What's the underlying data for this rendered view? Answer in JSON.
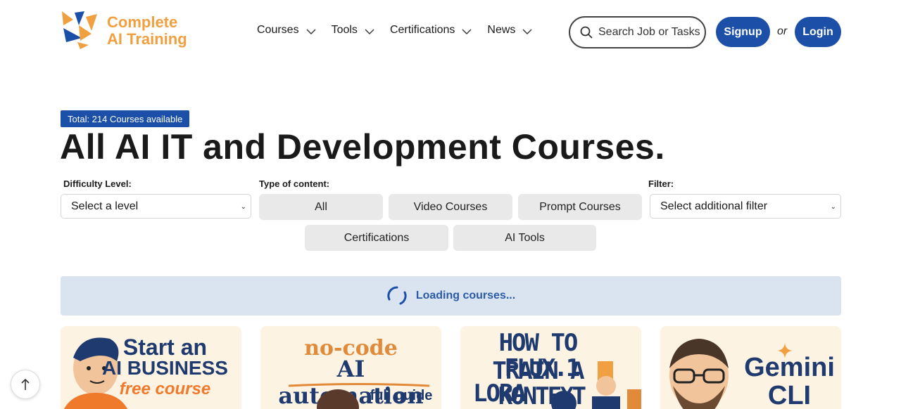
{
  "brand": {
    "line1": "Complete",
    "line2": "AI Training"
  },
  "nav": [
    {
      "label": "Courses"
    },
    {
      "label": "Tools"
    },
    {
      "label": "Certifications"
    },
    {
      "label": "News"
    }
  ],
  "search": {
    "placeholder": "Search Job or Tasks"
  },
  "auth": {
    "signup": "Signup",
    "or": "or",
    "login": "Login"
  },
  "badge": "Total: 214 Courses available",
  "page_title": "All AI IT and Development Courses.",
  "filters": {
    "difficulty_label": "Difficulty Level:",
    "difficulty_value": "Select a level",
    "type_label": "Type of content:",
    "filter_label": "Filter:",
    "filter_value": "Select additional filter",
    "types": [
      "All",
      "Video Courses",
      "Prompt Courses",
      "Certifications",
      "AI Tools"
    ]
  },
  "loading_text": "Loading courses...",
  "cards": [
    {
      "l1": "Start an",
      "l2": "AI BUSINESS",
      "l3": "free course"
    },
    {
      "l1": "no-code",
      "l2": "AI automation",
      "l3": "full guide"
    },
    {
      "l1": "HOW TO TRAIN A",
      "l2": "FLUX.1 KONTEXT",
      "l3": "LORA"
    },
    {
      "l1": "Gemini",
      "l2": "CLI"
    }
  ],
  "colors": {
    "brand_blue": "#1b4fa8",
    "logo_orange": "#f0a040",
    "loading_bg": "#d9e4f0"
  }
}
